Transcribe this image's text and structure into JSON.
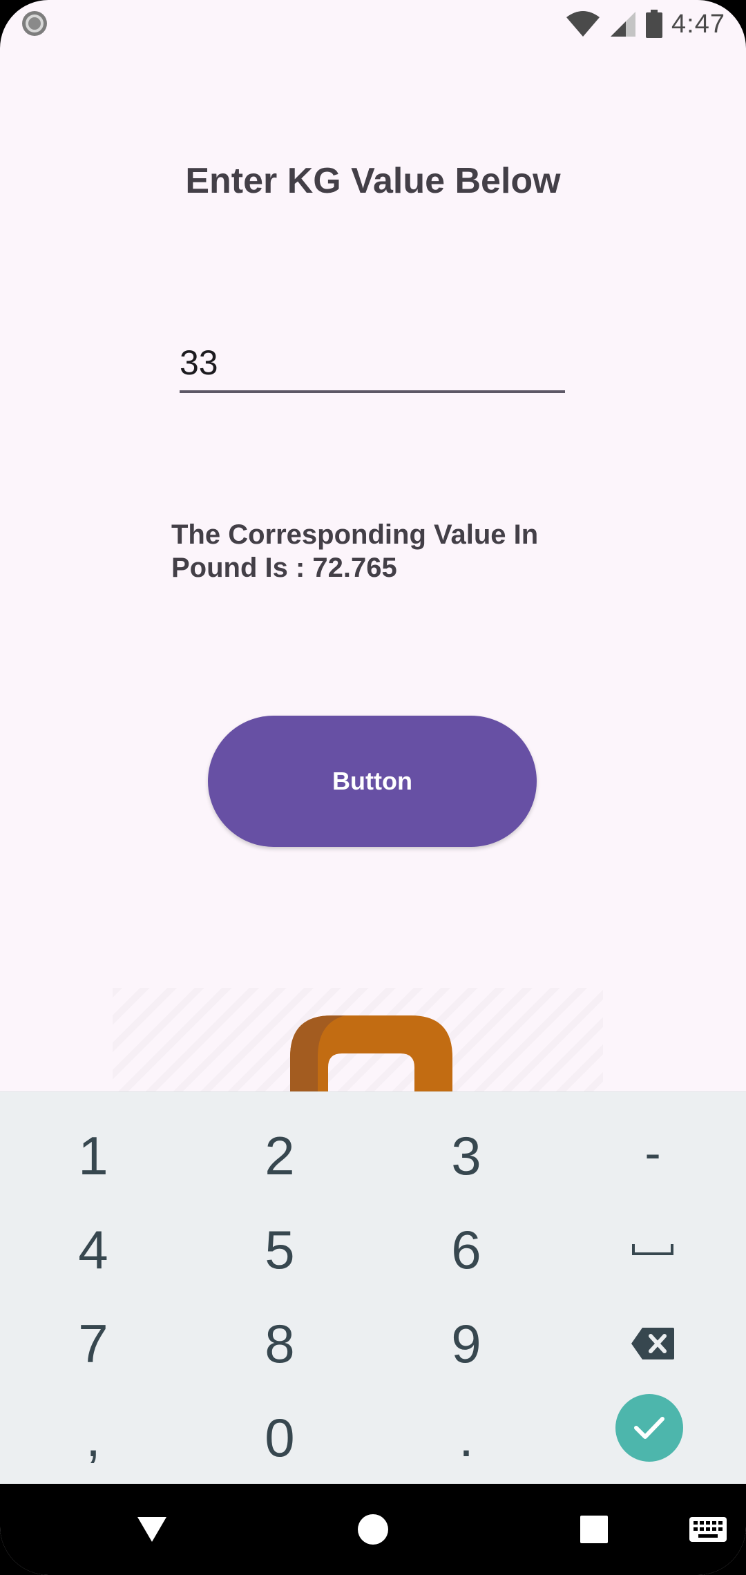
{
  "status_bar": {
    "time": "4:47"
  },
  "main": {
    "title": "Enter KG Value Below",
    "kg_input_value": "33",
    "result_line1": "The Corresponding Value In",
    "result_line2": "Pound Is : 72.765",
    "button_label": "Button"
  },
  "keyboard": {
    "rows": [
      [
        "1",
        "2",
        "3",
        "-"
      ],
      [
        "4",
        "5",
        "6",
        "space"
      ],
      [
        "7",
        "8",
        "9",
        "backspace"
      ],
      [
        ",",
        "0",
        ".",
        "done"
      ]
    ],
    "labels": {
      "k1": "1",
      "k2": "2",
      "k3": "3",
      "k_minus": "-",
      "k4": "4",
      "k5": "5",
      "k6": "6",
      "k7": "7",
      "k8": "8",
      "k9": "9",
      "k_comma": ",",
      "k0": "0",
      "k_period": "."
    },
    "done_color": "#4db6ac"
  },
  "colors": {
    "accent": "#6750a4",
    "background": "#fcf5fb",
    "keyboard_bg": "#eceff1"
  },
  "icons": {
    "status": [
      "record-icon",
      "wifi-icon",
      "cell-signal-icon",
      "battery-icon"
    ],
    "nav": [
      "back-icon",
      "home-icon",
      "recents-icon",
      "keyboard-icon"
    ]
  }
}
